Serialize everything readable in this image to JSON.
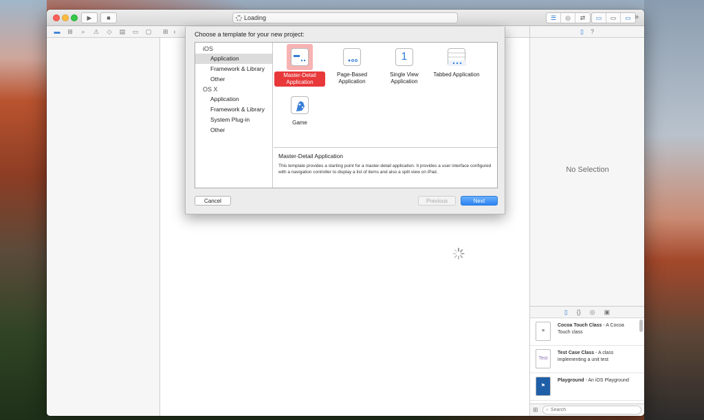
{
  "window": {
    "activity_text": "Loading",
    "titlebar_overflow": "»"
  },
  "navigator_tabs": [
    "folder-icon",
    "hierarchy-icon",
    "search-icon",
    "warning-icon",
    "test-icon",
    "debug-icon",
    "breakpoint-icon",
    "report-icon"
  ],
  "jumpbar": {
    "grid": "⊞",
    "back": "‹"
  },
  "sheet": {
    "title": "Choose a template for your new project:",
    "platforms": [
      {
        "heading": "iOS",
        "items": [
          "Application",
          "Framework & Library",
          "Other"
        ]
      },
      {
        "heading": "OS X",
        "items": [
          "Application",
          "Framework & Library",
          "System Plug-in",
          "Other"
        ]
      }
    ],
    "selected_platform_item": "Application",
    "templates": [
      {
        "label": "Master-Detail Application",
        "icon": "master-detail-icon",
        "selected": true
      },
      {
        "label": "Page-Based Application",
        "icon": "page-based-icon",
        "selected": false
      },
      {
        "label": "Single View Application",
        "icon": "single-view-icon",
        "glyph": "1",
        "selected": false
      },
      {
        "label": "Tabbed Application",
        "icon": "tabbed-icon",
        "selected": false
      },
      {
        "label": "Game",
        "icon": "game-icon",
        "selected": false
      }
    ],
    "description": {
      "title": "Master-Detail Application",
      "text": "This template provides a starting point for a master-detail application. It provides a user interface configured with a navigation controller to display a list of items and also a split view on iPad."
    },
    "buttons": {
      "cancel": "Cancel",
      "previous": "Previous",
      "next": "Next"
    }
  },
  "inspector": {
    "empty_text": "No Selection"
  },
  "library": {
    "items": [
      {
        "name": "Cocoa Touch Class",
        "desc": " - A Cocoa Touch class",
        "icon": "swift-file-icon"
      },
      {
        "name": "Test Case Class",
        "desc": " - A class implementing a unit test",
        "icon": "test-file-icon",
        "glyph": "Test"
      },
      {
        "name": "Playground",
        "desc": " - An iOS Playground",
        "icon": "playground-icon"
      }
    ],
    "filter_placeholder": "Search"
  },
  "colors": {
    "accent": "#2f7bd6",
    "selection_red": "#e8383a",
    "next_button": "#2d84f1"
  }
}
